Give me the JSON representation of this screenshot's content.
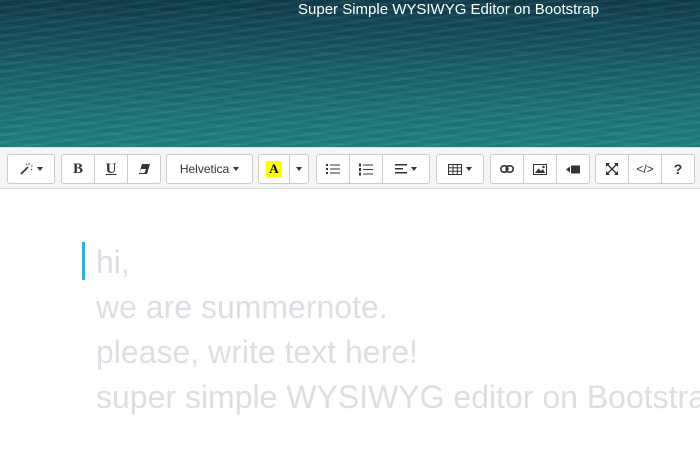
{
  "hero": {
    "tagline": "Super Simple WYSIWYG Editor on Bootstrap"
  },
  "toolbar": {
    "style_group": {
      "icon": "magic-wand-icon"
    },
    "font_style": {
      "bold_label": "B",
      "underline_label": "U",
      "clear_icon": "eraser-icon"
    },
    "font_name": {
      "value": "Helvetica"
    },
    "color": {
      "label": "A",
      "highlight_color": "#ffff00"
    },
    "paragraph": {
      "unordered_list_icon": "unordered-list-icon",
      "ordered_list_icon": "ordered-list-icon",
      "align_icon": "align-left-icon"
    },
    "table": {
      "icon": "table-icon"
    },
    "insert": {
      "link_icon": "link-icon",
      "picture_icon": "picture-icon",
      "video_icon": "video-icon"
    },
    "view": {
      "fullscreen_icon": "fullscreen-icon",
      "codeview_label": "</>",
      "help_label": "?"
    }
  },
  "editor": {
    "placeholder_lines": [
      "hi,",
      "we are summernote.",
      "please, write text here!",
      "super simple WYSIWYG editor on Bootstrap"
    ],
    "cursor_color": "#35aede"
  }
}
